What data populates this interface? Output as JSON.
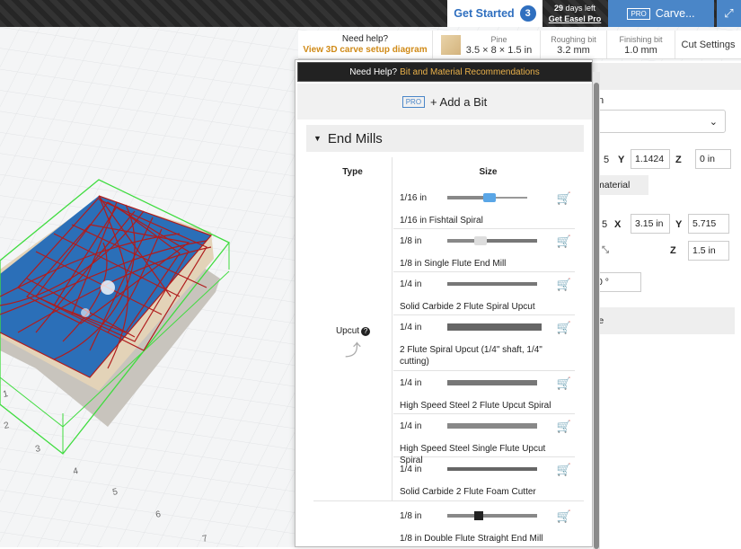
{
  "topbar": {
    "get_started_label": "Get Started",
    "get_started_count": "3",
    "trial_days": "29",
    "trial_text": "days left",
    "trial_link": "Get Easel Pro",
    "carve_pro_badge": "PRO",
    "carve_label": "Carve..."
  },
  "subbar": {
    "help_title": "Need help?",
    "help_link": "View 3D carve setup diagram",
    "material_label": "Pine",
    "material_size": "3.5 × 8 × 1.5 in",
    "roughing_label": "Roughing bit",
    "roughing_value": "3.2 mm",
    "finishing_label": "Finishing bit",
    "finishing_value": "1.0 mm",
    "cut_settings": "Cut Settings"
  },
  "right_panel": {
    "letter_n": "n",
    "y_label": "Y",
    "y_value": "1.1424",
    "z_label": "Z",
    "z_value": "0 in",
    "material_btn": "material",
    "x2_label": "X",
    "x2_value": "3.15 in",
    "y2_label": "Y",
    "y2_value": "5.715",
    "z2_label": "Z",
    "z2_value": "1.5 in",
    "rotation_value": "0 °",
    "section_label": "le",
    "left_frag": "5"
  },
  "bit_panel": {
    "help_prefix": "Need Help?",
    "help_link": "Bit and Material Recommendations",
    "add_pro_badge": "PRO",
    "add_label": "+ Add a Bit",
    "section_title": "End Mills",
    "col_type": "Type",
    "col_size": "Size",
    "type_upcut": "Upcut",
    "bits": [
      {
        "size": "1/16 in",
        "name": "1/16 in Fishtail Spiral"
      },
      {
        "size": "1/8 in",
        "name": "1/8 in Single Flute End Mill"
      },
      {
        "size": "1/4 in",
        "name": "Solid Carbide 2 Flute Spiral Upcut"
      },
      {
        "size": "1/4 in",
        "name": "2 Flute Spiral Upcut (1/4\" shaft, 1/4\" cutting)"
      },
      {
        "size": "1/4 in",
        "name": "High Speed Steel 2 Flute Upcut Spiral"
      },
      {
        "size": "1/4 in",
        "name": "High Speed Steel Single Flute Upcut Spiral"
      },
      {
        "size": "1/4 in",
        "name": "Solid Carbide 2 Flute Foam Cutter"
      },
      {
        "size": "1/8 in",
        "name": "1/8 in Double Flute Straight End Mill"
      }
    ]
  },
  "axis_labels": [
    "1",
    "2",
    "3",
    "4",
    "5",
    "6",
    "7"
  ],
  "colors": {
    "accent": "#4a86c8",
    "warning": "#d08a17",
    "toolpath": "#b01c1c",
    "stock": "#2a6fb8"
  }
}
